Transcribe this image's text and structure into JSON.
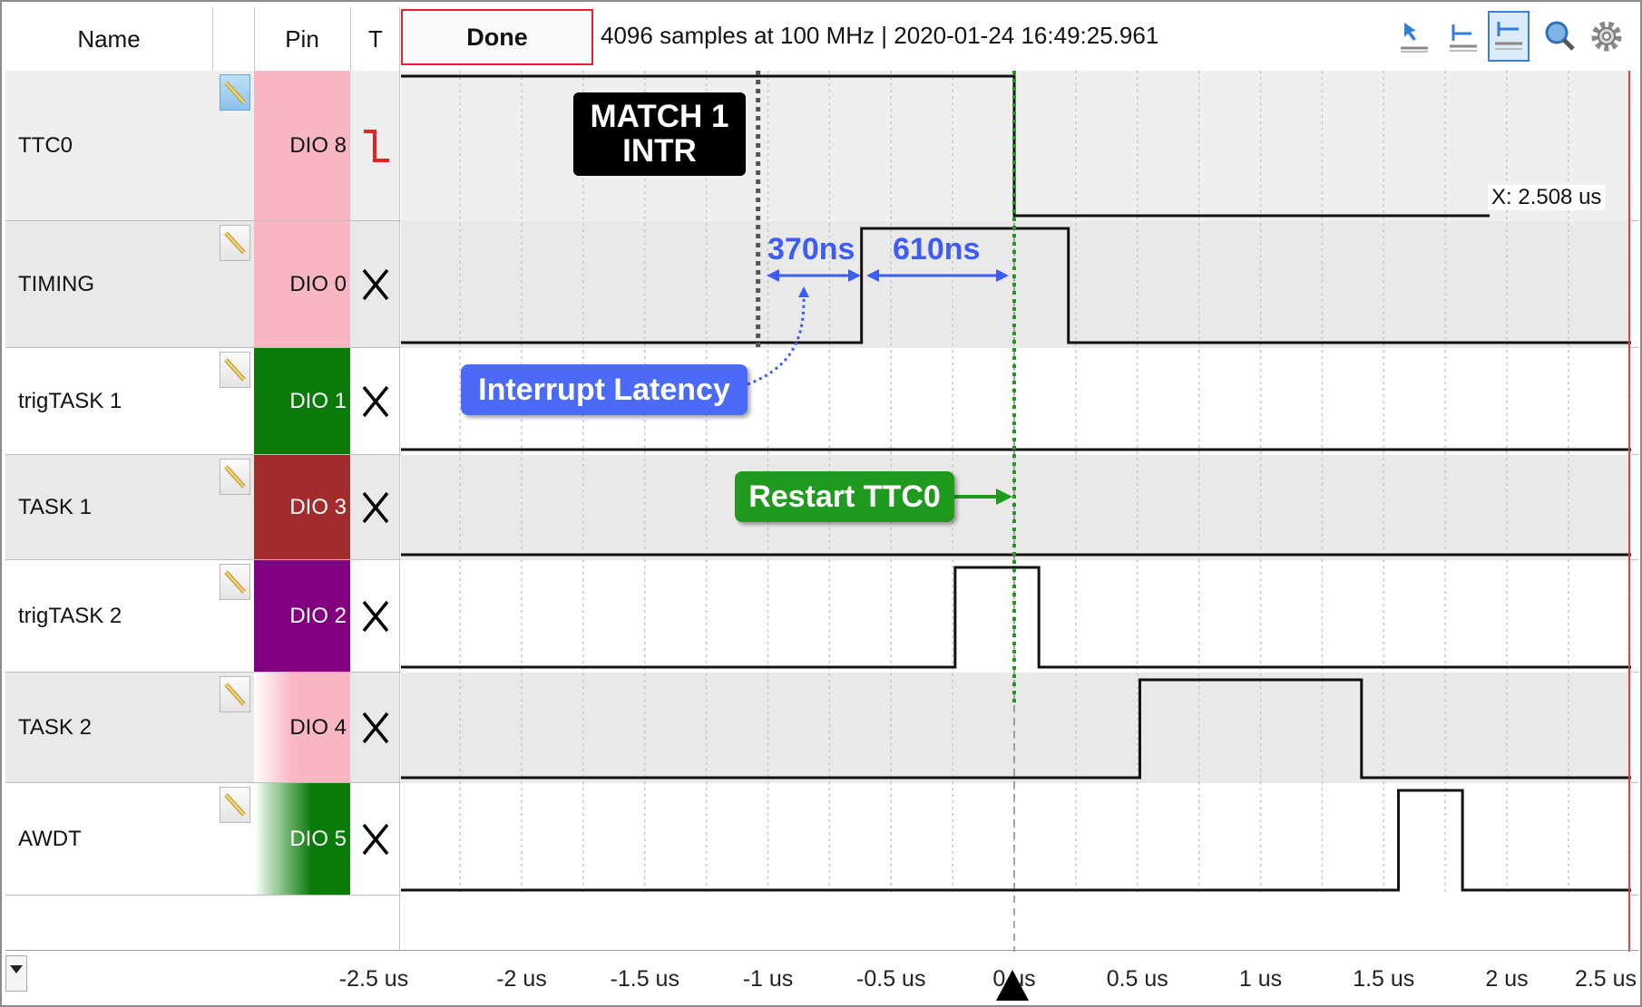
{
  "header": {
    "name_col": "Name",
    "pin_col": "Pin",
    "trigger_col": "T",
    "done_label": "Done",
    "status_text": "4096 samples at 100 MHz | 2020-01-24 16:49:25.961"
  },
  "toolbar": {
    "icons": [
      "cursor-arrow-icon",
      "trigger-left-icon",
      "trigger-center-icon",
      "zoom-icon",
      "settings-gear-icon"
    ],
    "active_index": 2
  },
  "channels": [
    {
      "name": "TTC0",
      "pin": "DIO 8",
      "trigger": "falling-edge",
      "color": "#f8b6c3"
    },
    {
      "name": "TIMING",
      "pin": "DIO 0",
      "trigger": "X",
      "color": "#f8b6c3"
    },
    {
      "name": "trigTASK 1",
      "pin": "DIO 1",
      "trigger": "X",
      "color": "#0a7a0a"
    },
    {
      "name": "TASK 1",
      "pin": "DIO 3",
      "trigger": "X",
      "color": "#a22b2b"
    },
    {
      "name": "trigTASK 2",
      "pin": "DIO 2",
      "trigger": "X",
      "color": "#800080"
    },
    {
      "name": "TASK 2",
      "pin": "DIO 4",
      "trigger": "X",
      "color": "#f8b6c3"
    },
    {
      "name": "AWDT",
      "pin": "DIO 5",
      "trigger": "X",
      "color": "#0a7a0a"
    }
  ],
  "cursor_readout": "X: 2.508 us",
  "annotations": {
    "match_intr": "MATCH 1\nINTR",
    "interrupt_latency": "Interrupt Latency",
    "restart_ttc0": "Restart TTC0",
    "measure_1": "370ns",
    "measure_2": "610ns"
  },
  "chart_data": {
    "type": "line",
    "xlabel": "",
    "ylabel": "",
    "x_unit": "us",
    "xlim": [
      -2.5,
      2.5
    ],
    "x_ticks": [
      {
        "value": -2.5,
        "label": "-2.5 us"
      },
      {
        "value": -2.0,
        "label": "-2 us"
      },
      {
        "value": -1.5,
        "label": "-1.5 us"
      },
      {
        "value": -1.0,
        "label": "-1 us"
      },
      {
        "value": -0.5,
        "label": "-0.5 us"
      },
      {
        "value": 0.0,
        "label": "0 us"
      },
      {
        "value": 0.5,
        "label": "0.5 us"
      },
      {
        "value": 1.0,
        "label": "1 us"
      },
      {
        "value": 1.5,
        "label": "1.5 us"
      },
      {
        "value": 2.0,
        "label": "2 us"
      },
      {
        "value": 2.5,
        "label": "2.5 us"
      }
    ],
    "series": [
      {
        "name": "TTC0",
        "initial": 1,
        "edges": [
          0.0
        ],
        "end": 1.93
      },
      {
        "name": "TIMING",
        "initial": 0,
        "edges": [
          -0.62,
          0.22
        ]
      },
      {
        "name": "trigTASK 1",
        "initial": 0,
        "edges": []
      },
      {
        "name": "TASK 1",
        "initial": 0,
        "edges": []
      },
      {
        "name": "trigTASK 2",
        "initial": 0,
        "edges": [
          -0.24,
          0.1
        ]
      },
      {
        "name": "TASK 2",
        "initial": 0,
        "edges": [
          0.51,
          1.41
        ]
      },
      {
        "name": "AWDT",
        "initial": 0,
        "edges": [
          1.56,
          1.82
        ]
      }
    ],
    "markers": [
      {
        "name": "MATCH 1 INTR",
        "x": -1.04,
        "color": "#555555"
      },
      {
        "name": "Restart TTC0",
        "x": 0.0,
        "color": "#1f9a1f"
      }
    ],
    "trigger_position": 0.0
  }
}
